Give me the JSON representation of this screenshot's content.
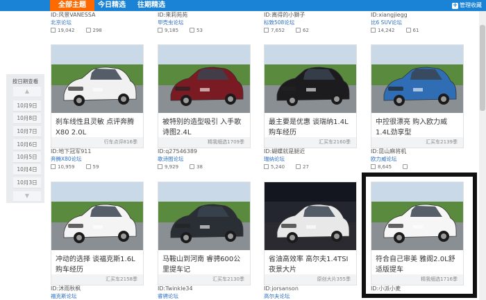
{
  "tabs": [
    {
      "label": "全部主题",
      "active": true
    },
    {
      "label": "今日精选",
      "active": false
    },
    {
      "label": "往期精选",
      "active": false
    }
  ],
  "manage_label": "管理收藏",
  "top_row": [
    {
      "id": "ID:风景VANESSA",
      "forum": "北京论坛",
      "views": "19,042",
      "comments": "298"
    },
    {
      "id": "ID:来莉苑苑",
      "forum": "甲壳虫论坛",
      "views": "9,185",
      "comments": "53"
    },
    {
      "id": "ID:离得的小獅子",
      "forum": "标致508论坛",
      "views": "7,652",
      "comments": "62"
    },
    {
      "id": "ID:xiangjiegg",
      "forum": "比6 SUV论坛",
      "views": "14,242",
      "comments": "61"
    }
  ],
  "date_sidebar": {
    "title": "按日期查看",
    "dates": [
      "10月9日",
      "10月8日",
      "10月7日",
      "10月6日",
      "10月5日",
      "10月4日",
      "10月3日"
    ]
  },
  "cards_row1": [
    {
      "title": "刹车线性且灵敏 点评奔腾X80 2.0L",
      "tag": "行车点评816季",
      "id": "ID:地下冠军911",
      "forum": "奔腾X80论坛",
      "views": "10,959",
      "comments": "59",
      "car_color": "#f1f1f1"
    },
    {
      "title": "被特别的造型吸引 入手歌诗图2.4L",
      "tag": "精我细选1709季",
      "id": "ID:q27546389",
      "forum": "歌诗图论坛",
      "views": "9,929",
      "comments": "38",
      "car_color": "#7a1a22"
    },
    {
      "title": "最主要是优惠 谈瑞纳1.4L购车经历",
      "tag": "汇买车2160季",
      "id": "ID:蝴蝶就是腿近",
      "forum": "瑞纳论坛",
      "views": "5,240",
      "comments": "27",
      "car_color": "#1c1c1e"
    },
    {
      "title": "中控很漂亮 购入欧力威1.4L劲享型",
      "tag": "汇买车2139季",
      "id": "ID:昆山麻将机",
      "forum": "欧力威论坛",
      "views": "8,645",
      "comments": "",
      "car_color": "#2f6db5"
    }
  ],
  "cards_row2": [
    {
      "title": "冲动的选择 谈福克斯1.6L购车经历",
      "tag": "汇买车2158季",
      "id": "ID:沐雨秋枫",
      "forum": "福克斯论坛",
      "car_color": "#f4f4f4"
    },
    {
      "title": "马鞍山到河南 睿骋600公里提车记",
      "tag": "汇买车2130季",
      "id": "ID:Twinkle34",
      "forum": "睿骋论坛",
      "car_color": "#2a2f35"
    },
    {
      "title": "省油高效率 高尔夫1.4TSI夜景大片",
      "tag": "原创大片355季",
      "id": "ID:jorsanson",
      "forum": "高尔夫论坛",
      "car_color": "#e8e8e8"
    },
    {
      "title": "符合自己审美 雅阁2.0L舒适版提车",
      "tag": "精我细选1716季",
      "id": "ID:小派小麦",
      "forum": "",
      "car_color": "#f6f6f6"
    }
  ],
  "colors": {
    "nav": "#1b83d6",
    "active_tab": "#ff6a00",
    "link": "#2a6ec4"
  }
}
